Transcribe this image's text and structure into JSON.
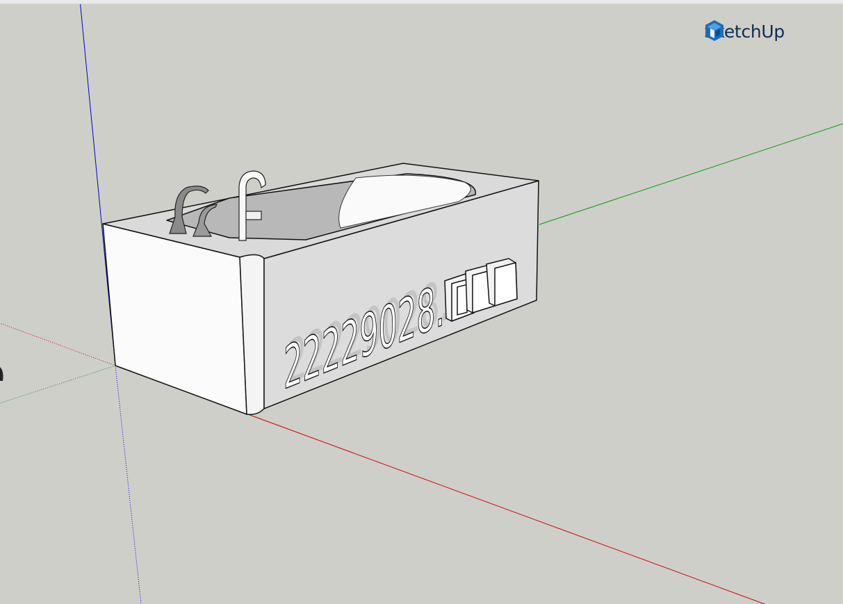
{
  "app": {
    "brand": "SketchUp",
    "icon": "sketchup-logo-icon",
    "brand_color": "#1c6fb3",
    "brand_text_color": "#0f2d4e"
  },
  "scene": {
    "background_color": "#cfcfca",
    "axes": {
      "red_axis_color": "#cc0000",
      "green_axis_color": "#00a000",
      "blue_axis_color": "#0000cc"
    },
    "model": {
      "name": "bathtub",
      "extruded_text": "22229028.",
      "fixtures": [
        "faucet-left",
        "faucet-spout-small",
        "faucet-main"
      ]
    }
  }
}
